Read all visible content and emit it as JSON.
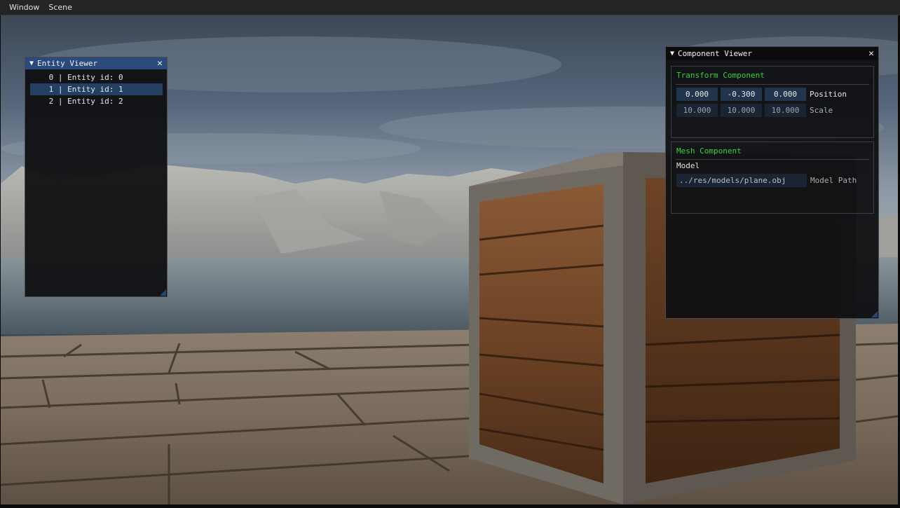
{
  "menu": [
    "Window",
    "Scene"
  ],
  "entity_viewer": {
    "title": "Entity Viewer",
    "entities": [
      {
        "text": " 0 | Entity id: 0"
      },
      {
        "text": " 1 | Entity id: 1"
      },
      {
        "text": " 2 | Entity id: 2"
      }
    ],
    "selected_index": 1
  },
  "component_viewer": {
    "title": "Component Viewer",
    "transform": {
      "header": "Transform Component",
      "position": {
        "values": [
          "0.000",
          "-0.300",
          "0.000"
        ],
        "label": "Position"
      },
      "scale": {
        "values": [
          "10.000",
          "10.000",
          "10.000"
        ],
        "label": "Scale"
      }
    },
    "mesh": {
      "header": "Mesh Component",
      "model_label": "Model",
      "model_path": "../res/models/plane.obj",
      "model_path_label": "Model Path"
    }
  },
  "colors": {
    "accent_title": "#294a7a",
    "selection": "#234063",
    "header_green": "#3ad13a",
    "field_bg": "#23344d"
  },
  "icons": {
    "collapse": "triangle-down-icon",
    "close": "close-icon"
  }
}
